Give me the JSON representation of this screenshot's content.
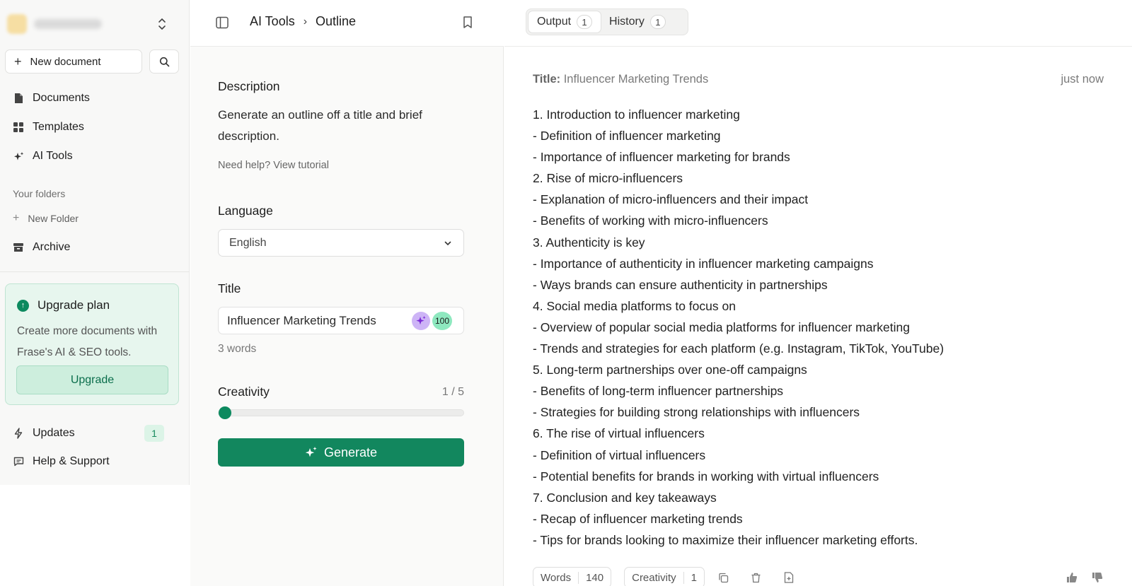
{
  "sidebar": {
    "new_document": "New document",
    "nav": [
      {
        "label": "Documents",
        "icon": "document-icon"
      },
      {
        "label": "Templates",
        "icon": "grid-icon"
      },
      {
        "label": "AI Tools",
        "icon": "sparkle-icon"
      }
    ],
    "folders_label": "Your folders",
    "new_folder": "New Folder",
    "archive": "Archive",
    "upgrade": {
      "title": "Upgrade plan",
      "description": "Create more documents with Frase's AI & SEO tools.",
      "button": "Upgrade"
    },
    "updates": {
      "label": "Updates",
      "count": "1"
    },
    "help": "Help & Support"
  },
  "middle": {
    "breadcrumb": {
      "parent": "AI Tools",
      "current": "Outline"
    },
    "description_label": "Description",
    "description": "Generate an outline off a title and brief description.",
    "help_link": "Need help? View tutorial",
    "language_label": "Language",
    "language_value": "English",
    "title_label": "Title",
    "title_value": "Influencer Marketing Trends",
    "title_score": "100",
    "word_count": "3 words",
    "creativity_label": "Creativity",
    "creativity_value": "1 / 5",
    "creativity_level": 1,
    "creativity_max": 5,
    "generate": "Generate"
  },
  "output": {
    "tabs": [
      {
        "label": "Output",
        "count": "1"
      },
      {
        "label": "History",
        "count": "1"
      }
    ],
    "title_prefix": "Title:",
    "title": "Influencer Marketing Trends",
    "timestamp": "just now",
    "lines": [
      "1. Introduction to influencer marketing",
      "- Definition of influencer marketing",
      "- Importance of influencer marketing for brands",
      "2. Rise of micro-influencers",
      "- Explanation of micro-influencers and their impact",
      "- Benefits of working with micro-influencers",
      "3. Authenticity is key",
      "- Importance of authenticity in influencer marketing campaigns",
      "- Ways brands can ensure authenticity in partnerships",
      "4. Social media platforms to focus on",
      "- Overview of popular social media platforms for influencer marketing",
      "- Trends and strategies for each platform (e.g. Instagram, TikTok, YouTube)",
      "5. Long-term partnerships over one-off campaigns",
      "- Benefits of long-term influencer partnerships",
      "- Strategies for building strong relationships with influencers",
      "6. The rise of virtual influencers",
      "- Definition of virtual influencers",
      "- Potential benefits for brands in working with virtual influencers",
      "7. Conclusion and key takeaways",
      "- Recap of influencer marketing trends",
      "- Tips for brands looking to maximize their influencer marketing efforts."
    ],
    "footer": {
      "words_label": "Words",
      "words_value": "140",
      "creativity_label": "Creativity",
      "creativity_value": "1"
    }
  },
  "colors": {
    "accent": "#12875e",
    "upgrade_bg": "#e7f6ee"
  }
}
